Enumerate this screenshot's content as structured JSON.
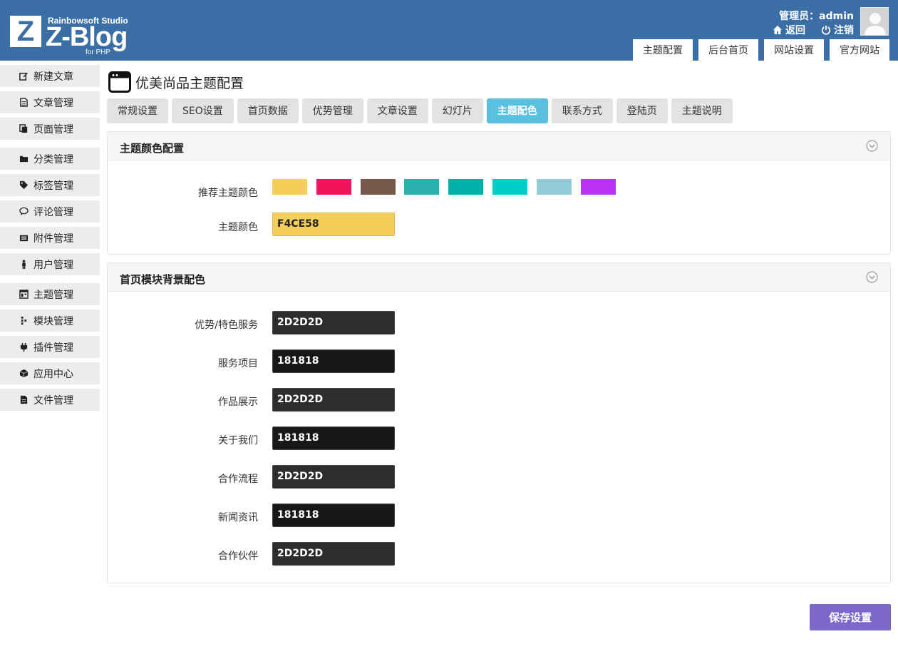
{
  "header": {
    "logo": {
      "studio": "Rainbowsoft Studio",
      "name": "Z-Blog",
      "sub": "for PHP",
      "mark": "Z"
    },
    "admin_label": "管理员：admin",
    "links": [
      {
        "label": "返回",
        "icon": "home-icon"
      },
      {
        "label": "注销",
        "icon": "power-icon"
      }
    ],
    "tabs": [
      "主题配置",
      "后台首页",
      "网站设置",
      "官方网站"
    ]
  },
  "sidebar": {
    "items": [
      {
        "label": "新建文章",
        "icon": "edit-icon"
      },
      {
        "label": "文章管理",
        "icon": "document-icon"
      },
      {
        "label": "页面管理",
        "icon": "pages-icon"
      },
      {
        "label": "分类管理",
        "icon": "folder-icon"
      },
      {
        "label": "标签管理",
        "icon": "tag-icon"
      },
      {
        "label": "评论管理",
        "icon": "comment-icon"
      },
      {
        "label": "附件管理",
        "icon": "attachment-icon"
      },
      {
        "label": "用户管理",
        "icon": "user-icon"
      },
      {
        "label": "主题管理",
        "icon": "theme-icon"
      },
      {
        "label": "模块管理",
        "icon": "module-icon"
      },
      {
        "label": "插件管理",
        "icon": "plugin-icon"
      },
      {
        "label": "应用中心",
        "icon": "box-icon"
      },
      {
        "label": "文件管理",
        "icon": "file-icon"
      }
    ]
  },
  "main": {
    "title": "优美尚品主题配置",
    "tabs": [
      "常规设置",
      "SEO设置",
      "首页数据",
      "优势管理",
      "文章设置",
      "幻灯片",
      "主题配色",
      "联系方式",
      "登陆页",
      "主题说明"
    ],
    "active_tab": "主题配色",
    "panel_theme": {
      "title": "主题颜色配置",
      "recommend_label": "推荐主题颜色",
      "swatches": [
        "#F4CE58",
        "#F0145A",
        "#76574A",
        "#2AAEAE",
        "#02AFA6",
        "#00CFC8",
        "#93CED8",
        "#B932F1"
      ],
      "color_label": "主题颜色",
      "color_value": "F4CE58"
    },
    "panel_bg": {
      "title": "首页模块背景配色",
      "rows": [
        {
          "label": "优势/特色服务",
          "value": "2D2D2D"
        },
        {
          "label": "服务项目",
          "value": "181818"
        },
        {
          "label": "作品展示",
          "value": "2D2D2D"
        },
        {
          "label": "关于我们",
          "value": "181818"
        },
        {
          "label": "合作流程",
          "value": "2D2D2D"
        },
        {
          "label": "新闻资讯",
          "value": "181818"
        },
        {
          "label": "合作伙伴",
          "value": "2D2D2D"
        }
      ]
    },
    "save_label": "保存设置"
  },
  "colors": {
    "header_bg": "#3A6EA5",
    "active_tab": "#5BC0DE",
    "save_button": "#7B68C8"
  }
}
